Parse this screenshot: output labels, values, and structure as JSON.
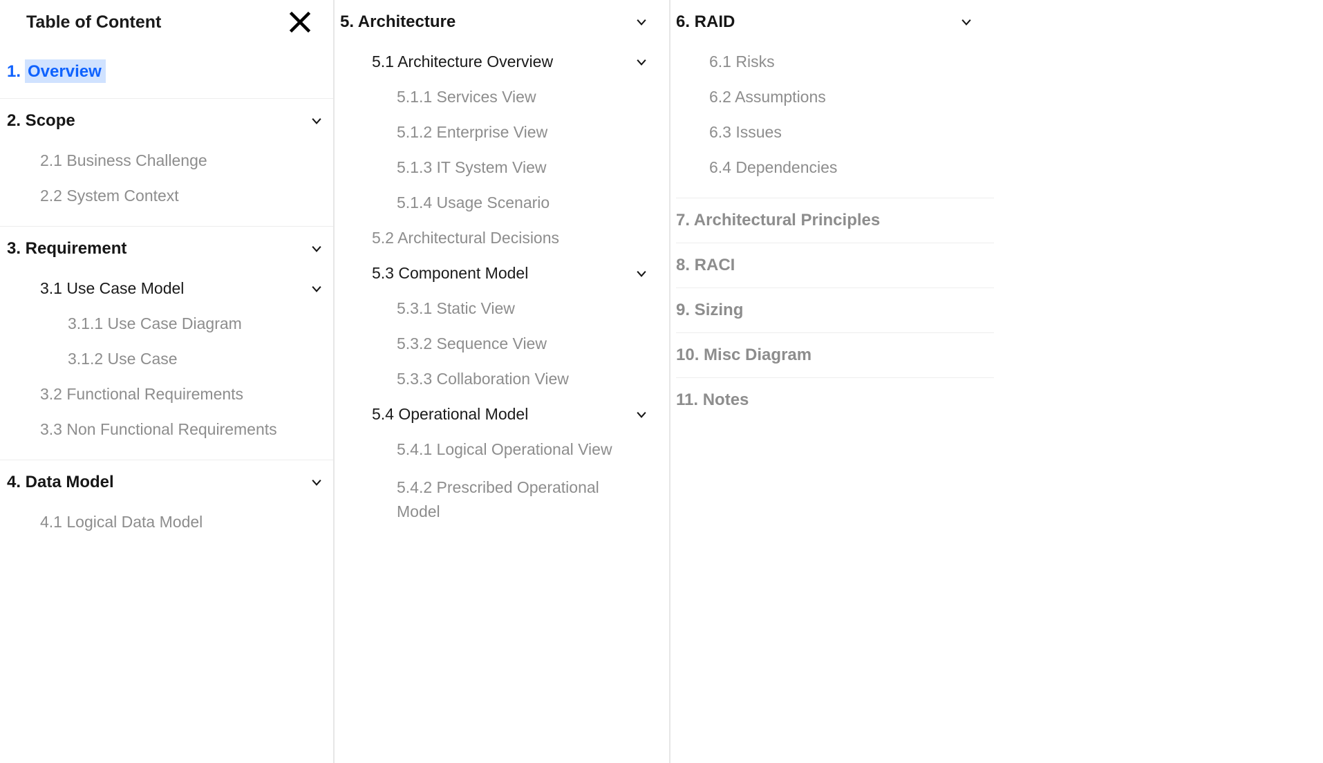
{
  "header": {
    "title": "Table of Content"
  },
  "toc": {
    "s1": {
      "label": "1. Overview"
    },
    "s2": {
      "label": "2. Scope",
      "c1": "2.1 Business Challenge",
      "c2": "2.2 System Context"
    },
    "s3": {
      "label": "3. Requirement",
      "c1": {
        "label": "3.1 Use Case Model",
        "g1": "3.1.1 Use Case Diagram",
        "g2": "3.1.2 Use Case"
      },
      "c2": "3.2 Functional Requirements",
      "c3": "3.3 Non Functional Requirements"
    },
    "s4": {
      "label": "4. Data Model",
      "c1": "4.1 Logical Data Model"
    },
    "s5": {
      "label": "5. Architecture",
      "c1": {
        "label": "5.1 Architecture Overview",
        "g1": "5.1.1 Services View",
        "g2": "5.1.2 Enterprise View",
        "g3": "5.1.3 IT System View",
        "g4": "5.1.4 Usage Scenario"
      },
      "c2": "5.2 Architectural Decisions",
      "c3": {
        "label": "5.3 Component Model",
        "g1": "5.3.1 Static View",
        "g2": "5.3.2 Sequence View",
        "g3": "5.3.3 Collaboration View"
      },
      "c4": {
        "label": "5.4 Operational Model",
        "g1": "5.4.1 Logical Operational View",
        "g2": "5.4.2 Prescribed Operational Model"
      }
    },
    "s6": {
      "label": "6. RAID",
      "c1": "6.1 Risks",
      "c2": "6.2 Assumptions",
      "c3": "6.3 Issues",
      "c4": "6.4 Dependencies"
    },
    "s7": {
      "label": "7. Architectural Principles"
    },
    "s8": {
      "label": "8. RACI"
    },
    "s9": {
      "label": "9. Sizing"
    },
    "s10": {
      "label": "10. Misc Diagram"
    },
    "s11": {
      "label": "11. Notes"
    }
  }
}
